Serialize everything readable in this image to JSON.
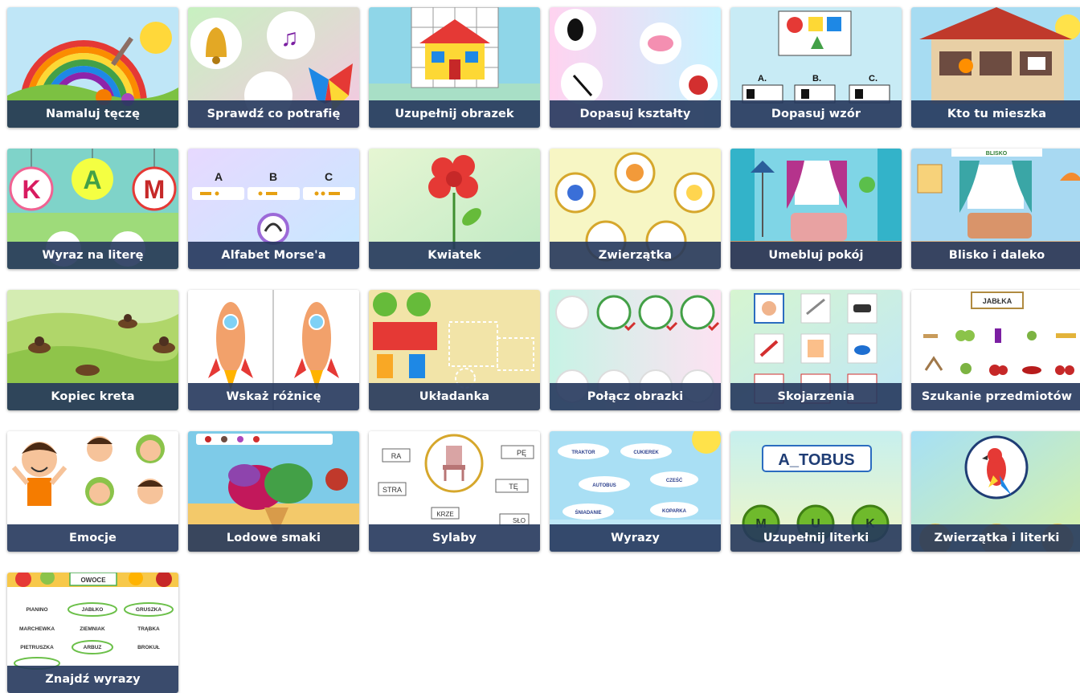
{
  "games": [
    {
      "title": "Namaluj tęczę",
      "icon": "rainbow-icon"
    },
    {
      "title": "Sprawdź co potrafię",
      "icon": "bell-icon"
    },
    {
      "title": "Uzupełnij obrazek",
      "icon": "house-icon"
    },
    {
      "title": "Dopasuj kształty",
      "icon": "shapes-icon"
    },
    {
      "title": "Dopasuj wzór",
      "icon": "pattern-icon",
      "options": [
        "A.",
        "B.",
        "C."
      ]
    },
    {
      "title": "Kto tu mieszka",
      "icon": "birdhouse-icon"
    },
    {
      "title": "Wyraz na literę",
      "icon": "letters-icon",
      "letters": [
        "K",
        "A",
        "M"
      ]
    },
    {
      "title": "Alfabet Morse'a",
      "icon": "morse-icon",
      "letters": [
        "A",
        "B",
        "C"
      ]
    },
    {
      "title": "Kwiatek",
      "icon": "flower-icon"
    },
    {
      "title": "Zwierzątka",
      "icon": "animals-icon"
    },
    {
      "title": "Umebluj pokój",
      "icon": "room-icon"
    },
    {
      "title": "Blisko i daleko",
      "icon": "room-near-far-icon",
      "sign": "BLISKO"
    },
    {
      "title": "Kopiec kreta",
      "icon": "mole-icon"
    },
    {
      "title": "Wskaż różnicę",
      "icon": "rocket-icon"
    },
    {
      "title": "Układanka",
      "icon": "puzzle-icon"
    },
    {
      "title": "Połącz obrazki",
      "icon": "connect-pictures-icon"
    },
    {
      "title": "Skojarzenia",
      "icon": "associations-icon"
    },
    {
      "title": "Szukanie przedmiotów",
      "icon": "search-items-icon",
      "label": "JABŁKA"
    },
    {
      "title": "Emocje",
      "icon": "faces-icon"
    },
    {
      "title": "Lodowe smaki",
      "icon": "ice-cream-icon"
    },
    {
      "title": "Sylaby",
      "icon": "chair-icon",
      "syllables": [
        "RA",
        "STRA",
        "PĘ",
        "TĘ",
        "KRZE",
        "SŁO"
      ]
    },
    {
      "title": "Wyrazy",
      "icon": "words-icon",
      "words": [
        "TRAKTOR",
        "CUKIEREK",
        "AUTOBUS",
        "CZEŚĆ",
        "ŚNIADANIE",
        "KOPARKA"
      ]
    },
    {
      "title": "Uzupełnij literki",
      "icon": "letter-fill-icon",
      "word": "A_TOBUS",
      "buttons": [
        "M",
        "U",
        "K"
      ]
    },
    {
      "title": "Zwierzątka i literki",
      "icon": "parrot-icon"
    },
    {
      "title": "Znajdź wyrazy",
      "icon": "find-words-icon",
      "label": "OWOCE",
      "words": [
        "PIANINO",
        "JABŁKO",
        "GRUSZKA",
        "MARCHEWKA",
        "ZIEMNIAK",
        "TRĄBKA",
        "PIETRUSZKA",
        "ARBUZ",
        "BROKUŁ"
      ]
    }
  ]
}
